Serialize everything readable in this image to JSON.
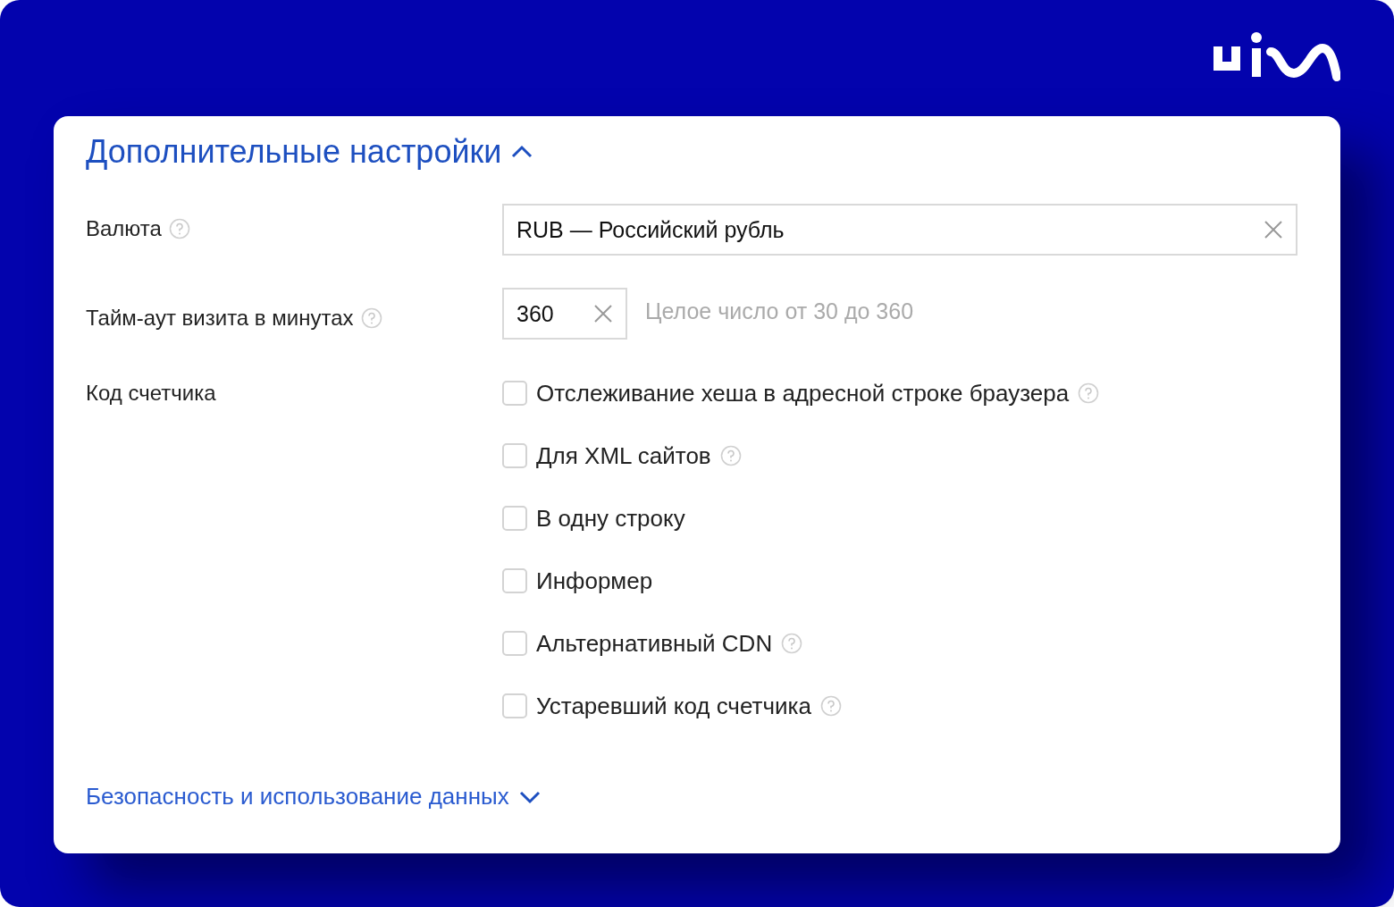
{
  "section": {
    "title": "Дополнительные настройки",
    "expanded": true
  },
  "fields": [
    {
      "kind": "select",
      "label": "Валюта",
      "help": true,
      "value": "RUB — Российский рубль"
    },
    {
      "kind": "number",
      "label": "Тайм-аут визита в минутах",
      "help": true,
      "value": "360",
      "hint": "Целое число от 30 до 360"
    }
  ],
  "counter_code": {
    "label": "Код счетчика",
    "options": [
      {
        "label": "Отслеживание хеша в адресной строке браузера",
        "checked": false,
        "help": true
      },
      {
        "label": "Для XML сайтов",
        "checked": false,
        "help": true
      },
      {
        "label": "В одну строку",
        "checked": false,
        "help": false
      },
      {
        "label": "Информер",
        "checked": false,
        "help": false
      },
      {
        "label": "Альтернативный CDN",
        "checked": false,
        "help": true
      },
      {
        "label": "Устаревший код счетчика",
        "checked": false,
        "help": true
      }
    ]
  },
  "footer_link": {
    "label": "Безопасность и использование данных",
    "expanded": false
  }
}
